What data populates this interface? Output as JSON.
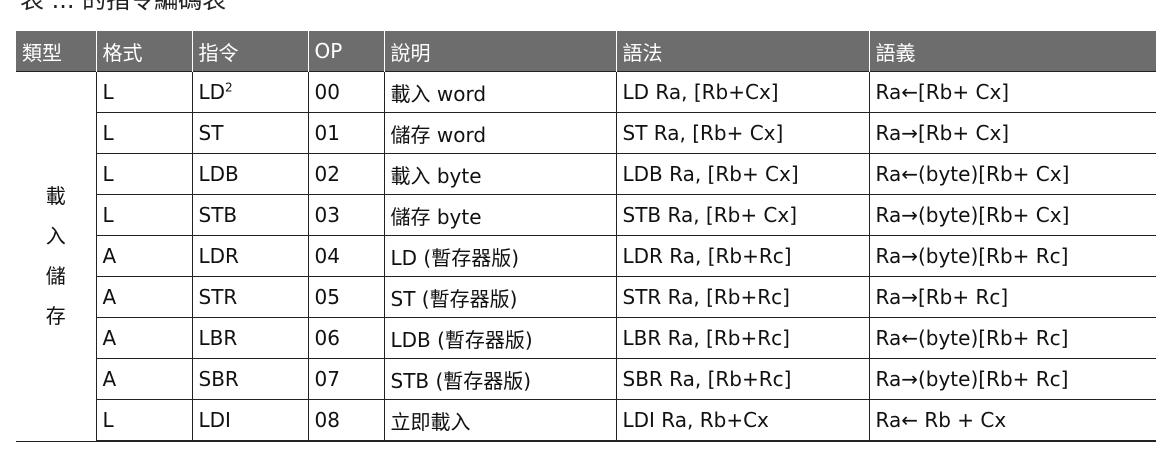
{
  "caption": "表 ... 的指令編碼表",
  "headers": [
    "類型",
    "格式",
    "指令",
    "OP",
    "說明",
    "語法",
    "語義"
  ],
  "category": "載入儲存",
  "rows": [
    {
      "format": "L",
      "instr": "LD",
      "sup": "2",
      "op": "00",
      "desc": "載入 word",
      "syntax": "LD Ra, [Rb+Cx]",
      "semantic": "Ra←[Rb+ Cx]"
    },
    {
      "format": "L",
      "instr": "ST",
      "sup": "",
      "op": "01",
      "desc": "儲存 word",
      "syntax": "ST Ra, [Rb+ Cx]",
      "semantic": "Ra→[Rb+ Cx]"
    },
    {
      "format": "L",
      "instr": "LDB",
      "sup": "",
      "op": "02",
      "desc": "載入 byte",
      "syntax": "LDB Ra, [Rb+ Cx]",
      "semantic": "Ra←(byte)[Rb+ Cx]"
    },
    {
      "format": "L",
      "instr": "STB",
      "sup": "",
      "op": "03",
      "desc": "儲存 byte",
      "syntax": "STB Ra, [Rb+ Cx]",
      "semantic": "Ra→(byte)[Rb+ Cx]"
    },
    {
      "format": "A",
      "instr": "LDR",
      "sup": "",
      "op": "04",
      "desc": "LD (暫存器版)",
      "syntax": "LDR Ra, [Rb+Rc]",
      "semantic": "Ra→(byte)[Rb+ Rc]"
    },
    {
      "format": "A",
      "instr": "STR",
      "sup": "",
      "op": "05",
      "desc": "ST (暫存器版)",
      "syntax": "STR Ra, [Rb+Rc]",
      "semantic": "Ra→[Rb+ Rc]"
    },
    {
      "format": "A",
      "instr": "LBR",
      "sup": "",
      "op": "06",
      "desc": "LDB (暫存器版)",
      "syntax": "LBR Ra, [Rb+Rc]",
      "semantic": "Ra←(byte)[Rb+ Rc]"
    },
    {
      "format": "A",
      "instr": "SBR",
      "sup": "",
      "op": "07",
      "desc": "STB (暫存器版)",
      "syntax": "SBR Ra, [Rb+Rc]",
      "semantic": "Ra→(byte)[Rb+ Rc]"
    },
    {
      "format": "L",
      "instr": "LDI",
      "sup": "",
      "op": "08",
      "desc": "立即載入",
      "syntax": "LDI Ra, Rb+Cx",
      "semantic": "Ra← Rb + Cx"
    }
  ]
}
